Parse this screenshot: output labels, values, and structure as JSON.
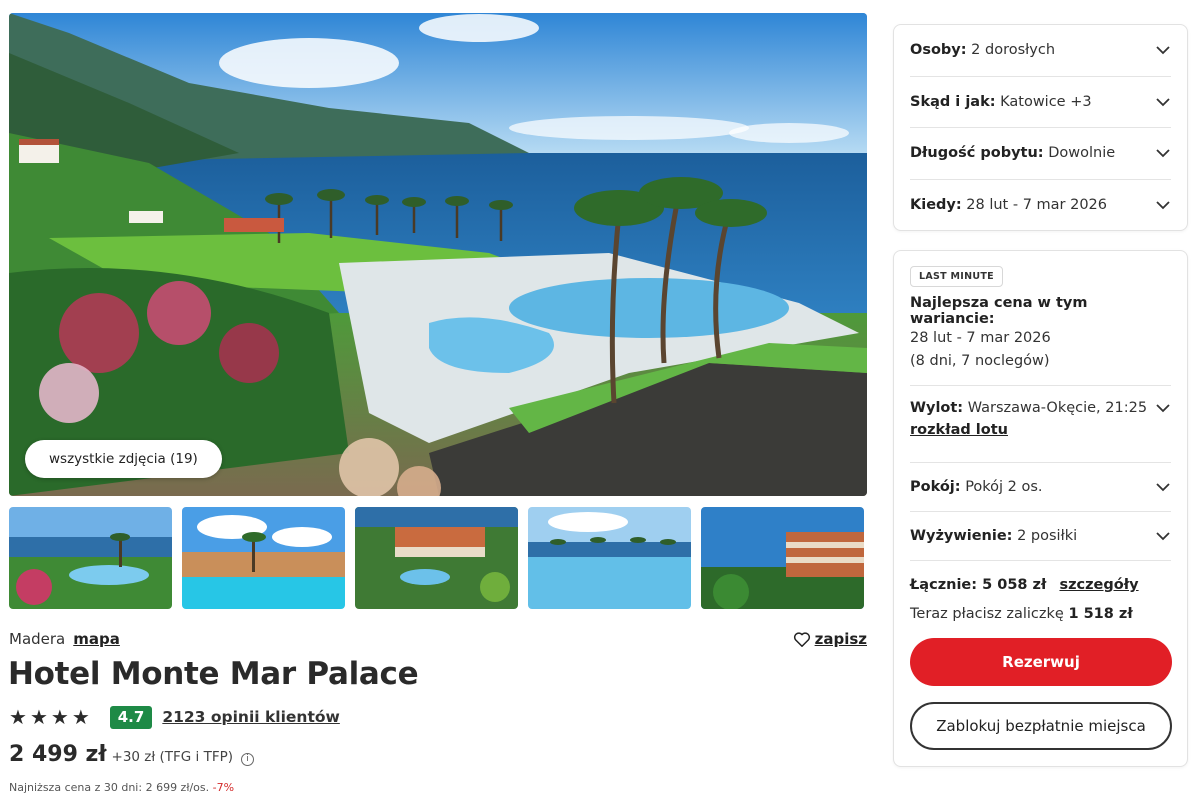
{
  "gallery": {
    "all_photos_label": "wszystkie zdjęcia (19)",
    "thumbnails": [
      "pool-ocean-view",
      "hotel-pool-garden",
      "hotel-aerial-cliff",
      "infinity-pool-ocean",
      "hotel-facade-ocean"
    ]
  },
  "hotel": {
    "region": "Madera",
    "map_label": "mapa",
    "save_label": "zapisz",
    "name": "Hotel Monte Mar Palace",
    "stars": 4,
    "score": "4.7",
    "reviews_label": "2123 opinii klientów",
    "price": "2 499 zł",
    "price_extra": "+30 zł (TFG i TFP)",
    "lowest_price_text": "Najniższa cena z 30 dni: 2 699 zł/os.",
    "lowest_price_change": "-7%"
  },
  "options": {
    "persons_label": "Osoby:",
    "persons_value": "2 dorosłych",
    "from_label": "Skąd i jak:",
    "from_value": "Katowice +3",
    "length_label": "Długość pobytu:",
    "length_value": "Dowolnie",
    "when_label": "Kiedy:",
    "when_value": "28 lut - 7 mar 2026"
  },
  "offer": {
    "badge": "LAST MINUTE",
    "best_title": "Najlepsza cena w tym wariancie:",
    "best_dates": "28 lut - 7 mar 2026",
    "best_duration": "(8 dni, 7 noclegów)",
    "flight_label": "Wylot:",
    "flight_value": "Warszawa-Okęcie, 21:25",
    "flight_schedule_label": "rozkład lotu",
    "room_label": "Pokój:",
    "room_value": "Pokój 2 os.",
    "board_label": "Wyżywienie:",
    "board_value": "2 posiłki",
    "total_label": "Łącznie: 5 058 zł",
    "details_label": "szczegóły",
    "deposit_text": "Teraz płacisz zaliczkę",
    "deposit_value": "1 518 zł",
    "reserve_label": "Rezerwuj",
    "block_label": "Zablokuj bezpłatnie miejsca"
  },
  "colors": {
    "accent": "#e11f26",
    "score_badge": "#1e8a46",
    "discount": "#d32a2a"
  }
}
